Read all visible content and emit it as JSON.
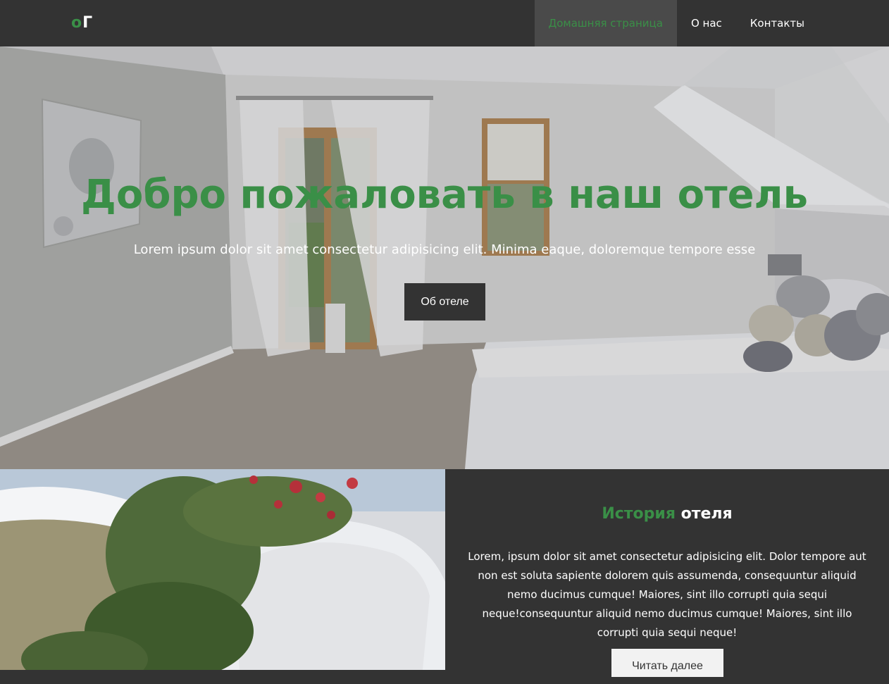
{
  "navbar": {
    "logo_first": "о",
    "logo_second": "Г",
    "links": [
      {
        "label": "Домашняя страница",
        "active": true
      },
      {
        "label": "О нас",
        "active": false
      },
      {
        "label": "Контакты",
        "active": false
      }
    ]
  },
  "hero": {
    "title": "Добро пожаловать в наш отель",
    "subtitle": "Lorem ipsum dolor sit amet consectetur adipisicing elit. Minima eaque, doloremque tempore esse",
    "button_label": "Об отеле"
  },
  "about": {
    "title_accent": "История",
    "title_rest": "отеля",
    "text": "Lorem, ipsum dolor sit amet consectetur adipisicing elit. Dolor tempore aut non est soluta sapiente dolorem quis assumenda, consequuntur aliquid nemo ducimus cumque! Maiores, sint illo corrupti quia sequi neque!consequuntur aliquid nemo ducimus cumque! Maiores, sint illo corrupti quia sequi neque!",
    "button_label": "Читать далее"
  },
  "colors": {
    "accent": "#3a8f47",
    "dark": "#333333"
  }
}
